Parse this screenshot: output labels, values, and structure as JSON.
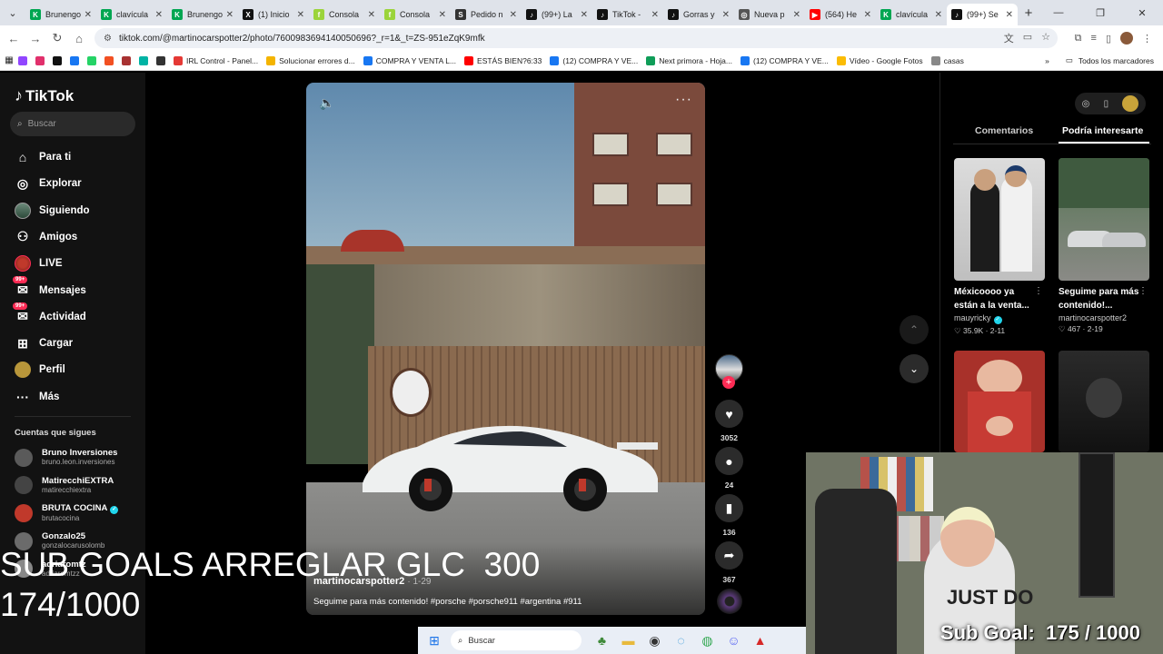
{
  "browser": {
    "tabs": [
      {
        "label": "Brunengo",
        "color": "#00a651",
        "glyph": "K",
        "active": false
      },
      {
        "label": "clavícula",
        "color": "#00a651",
        "glyph": "K",
        "active": false
      },
      {
        "label": "Brunengo",
        "color": "#00a651",
        "glyph": "K",
        "active": false
      },
      {
        "label": "(1) Inicio",
        "color": "#111111",
        "glyph": "X",
        "active": false
      },
      {
        "label": "Consola",
        "color": "#9bd43a",
        "glyph": "f",
        "active": false
      },
      {
        "label": "Consola",
        "color": "#9bd43a",
        "glyph": "f",
        "active": false
      },
      {
        "label": "Pedido n",
        "color": "#333333",
        "glyph": "S",
        "active": false
      },
      {
        "label": "(99+) La",
        "color": "#111111",
        "glyph": "♪",
        "active": false
      },
      {
        "label": "TikTok -",
        "color": "#111111",
        "glyph": "♪",
        "active": false
      },
      {
        "label": "Gorras y",
        "color": "#111111",
        "glyph": "♪",
        "active": false
      },
      {
        "label": "Nueva p",
        "color": "#555555",
        "glyph": "◎",
        "active": false
      },
      {
        "label": "(564) He",
        "color": "#ff0000",
        "glyph": "▶",
        "active": false
      },
      {
        "label": "clavícula",
        "color": "#00a651",
        "glyph": "K",
        "active": false
      },
      {
        "label": "(99+) Se",
        "color": "#111111",
        "glyph": "♪",
        "active": true
      }
    ],
    "url": "tiktok.com/@martinocarspotter2/photo/7600983694140050696?_r=1&_t=ZS-951eZqK9mfk",
    "bookmarks": [
      {
        "label": "",
        "color": "#9146ff"
      },
      {
        "label": "",
        "color": "#e1306c"
      },
      {
        "label": "",
        "color": "#111111"
      },
      {
        "label": "",
        "color": "#1877f2"
      },
      {
        "label": "",
        "color": "#25d366"
      },
      {
        "label": "",
        "color": "#f25022"
      },
      {
        "label": "",
        "color": "#a83232"
      },
      {
        "label": "",
        "color": "#00b3a4"
      },
      {
        "label": "",
        "color": "#333333"
      },
      {
        "label": "IRL Control - Panel...",
        "color": "#e53935"
      },
      {
        "label": "Solucionar errores d...",
        "color": "#f4b400"
      },
      {
        "label": "COMPRA Y VENTA L...",
        "color": "#1877f2"
      },
      {
        "label": "ESTÁS BIEN?6:33",
        "color": "#ff0000"
      },
      {
        "label": "(12) COMPRA Y VE...",
        "color": "#1877f2"
      },
      {
        "label": "Next primora - Hoja...",
        "color": "#0f9d58"
      },
      {
        "label": "(12) COMPRA Y VE...",
        "color": "#1877f2"
      },
      {
        "label": "Vídeo - Google Fotos",
        "color": "#fbbc04"
      },
      {
        "label": "casas",
        "color": "#888888"
      }
    ],
    "all_bookmarks": "Todos los marcadores"
  },
  "sidebar": {
    "brand": "TikTok",
    "search_placeholder": "Buscar",
    "nav": [
      {
        "label": "Para ti",
        "icon": "home-icon"
      },
      {
        "label": "Explorar",
        "icon": "compass-icon"
      },
      {
        "label": "Siguiendo",
        "icon": "following-avatar-icon"
      },
      {
        "label": "Amigos",
        "icon": "friends-icon"
      },
      {
        "label": "LIVE",
        "icon": "live-icon"
      },
      {
        "label": "Mensajes",
        "icon": "messages-icon",
        "badge": "99+"
      },
      {
        "label": "Actividad",
        "icon": "activity-icon",
        "badge": "99+"
      },
      {
        "label": "Cargar",
        "icon": "upload-icon"
      },
      {
        "label": "Perfil",
        "icon": "profile-icon"
      },
      {
        "label": "Más",
        "icon": "more-icon"
      }
    ],
    "following_header": "Cuentas que sigues",
    "following": [
      {
        "name": "Bruno Inversiones",
        "handle": "bruno.leon.inversiones",
        "color": "#5a5a5a"
      },
      {
        "name": "MatirecchiEXTRA",
        "handle": "matirecchiextra",
        "color": "#444444"
      },
      {
        "name": "BRUTA COCINA",
        "handle": "brutacocina",
        "color": "#c0392b",
        "verified": true
      },
      {
        "name": "Gonzalo25",
        "handle": "gonzalocarusolomb",
        "color": "#6b6b6b"
      },
      {
        "name": "adriaromtz",
        "handle": "adriaromtzz",
        "color": "#888888"
      }
    ]
  },
  "post": {
    "author": "martinocarspotter2",
    "date": "1-29",
    "caption": "Seguime para más contenido! #porsche #porsche911 #argentina #911",
    "likes": "3052",
    "comments": "24",
    "saves": "136",
    "shares": "367"
  },
  "right_panel": {
    "tabs": [
      "Comentarios",
      "Podría interesarte"
    ],
    "recommendations": [
      {
        "title": "Méxicoooo ya están a la venta...",
        "author": "mauyricky",
        "verified": true,
        "likes": "35.9K",
        "date": "2-11"
      },
      {
        "title": "Seguime para más contenido!...",
        "author": "martinocarspotter2",
        "verified": false,
        "likes": "467",
        "date": "2-19"
      },
      {
        "title": "",
        "author": "",
        "verified": false,
        "likes": "",
        "date": ""
      },
      {
        "title": "",
        "author": "",
        "verified": false,
        "likes": "",
        "date": ""
      }
    ]
  },
  "overlays": {
    "sub_goals_line1": "SUB GOALS ARREGLAR GLC  300",
    "sub_goals_line2": "174/1000",
    "cam_sub_goal": "Sub Goal:  175 / 1000",
    "shirt_text": "JUST DO"
  },
  "taskbar": {
    "search_placeholder": "Buscar"
  }
}
